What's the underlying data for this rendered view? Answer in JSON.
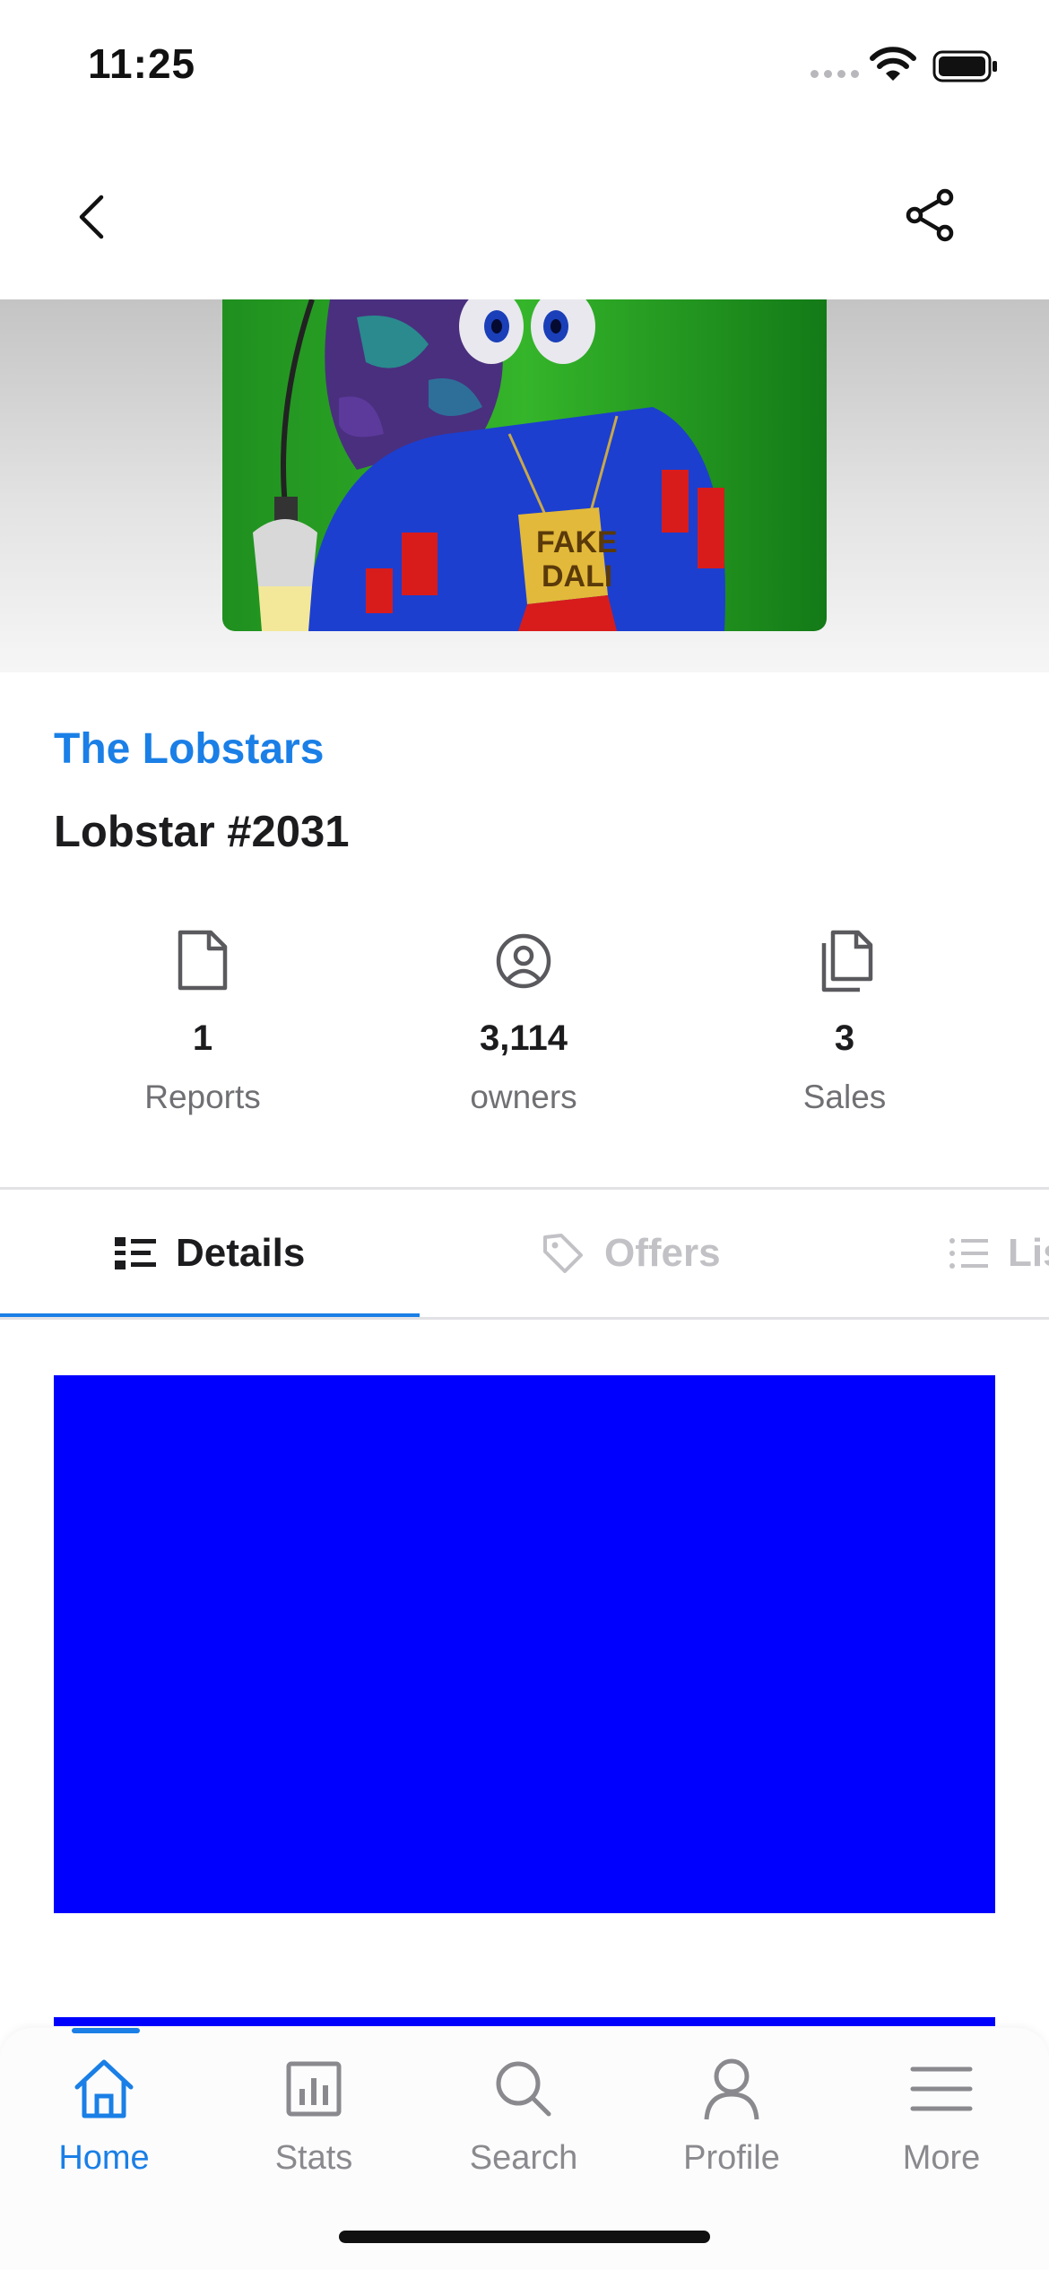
{
  "status_bar": {
    "time": "11:25"
  },
  "colors": {
    "accent": "#1a7fe6",
    "content_block": "#0000ff",
    "inactive_text": "#c2c2c6"
  },
  "nav": {
    "back_icon": "chevron-left-icon",
    "share_icon": "share-icon"
  },
  "collection": {
    "name": "The Lobstars"
  },
  "item": {
    "name": "Lobstar #2031"
  },
  "stats": [
    {
      "icon": "document-icon",
      "value": "1",
      "label": "Reports"
    },
    {
      "icon": "user-circle-icon",
      "value": "3,114",
      "label": "owners"
    },
    {
      "icon": "copies-icon",
      "value": "3",
      "label": "Sales"
    }
  ],
  "tabs": [
    {
      "icon": "details-list-icon",
      "label": "Details",
      "active": true
    },
    {
      "icon": "tag-icon",
      "label": "Offers",
      "active": false
    },
    {
      "icon": "list-icon",
      "label": "Lis",
      "active": false
    }
  ],
  "tab_bar": {
    "items": [
      {
        "icon": "home-icon",
        "label": "Home",
        "active": true
      },
      {
        "icon": "stats-icon",
        "label": "Stats",
        "active": false
      },
      {
        "icon": "search-icon",
        "label": "Search",
        "active": false
      },
      {
        "icon": "profile-icon",
        "label": "Profile",
        "active": false
      },
      {
        "icon": "menu-icon",
        "label": "More",
        "active": false
      }
    ]
  }
}
